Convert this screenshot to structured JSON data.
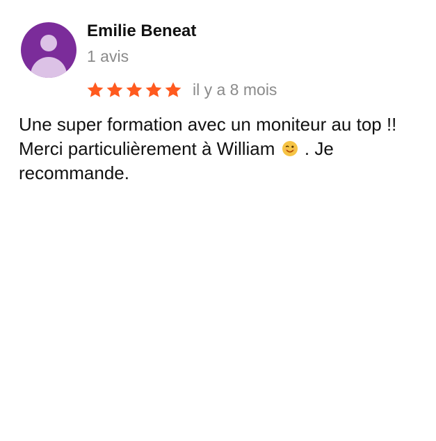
{
  "review": {
    "author": {
      "name": "Emilie Beneat",
      "review_count": "1 avis",
      "avatar_icon": "person-avatar-icon",
      "avatar_color": "#7b2c9a"
    },
    "rating": {
      "value": 5,
      "max": 5,
      "star_color": "#ff5a1f",
      "star_icon": "star-icon"
    },
    "time_ago": "il y a 8 mois",
    "text": {
      "part1": "Une super formation avec un moniteur au top !! Merci particulièrement à William",
      "emoji_icon": "winking-face-icon",
      "part2": " . Je recommande."
    }
  }
}
